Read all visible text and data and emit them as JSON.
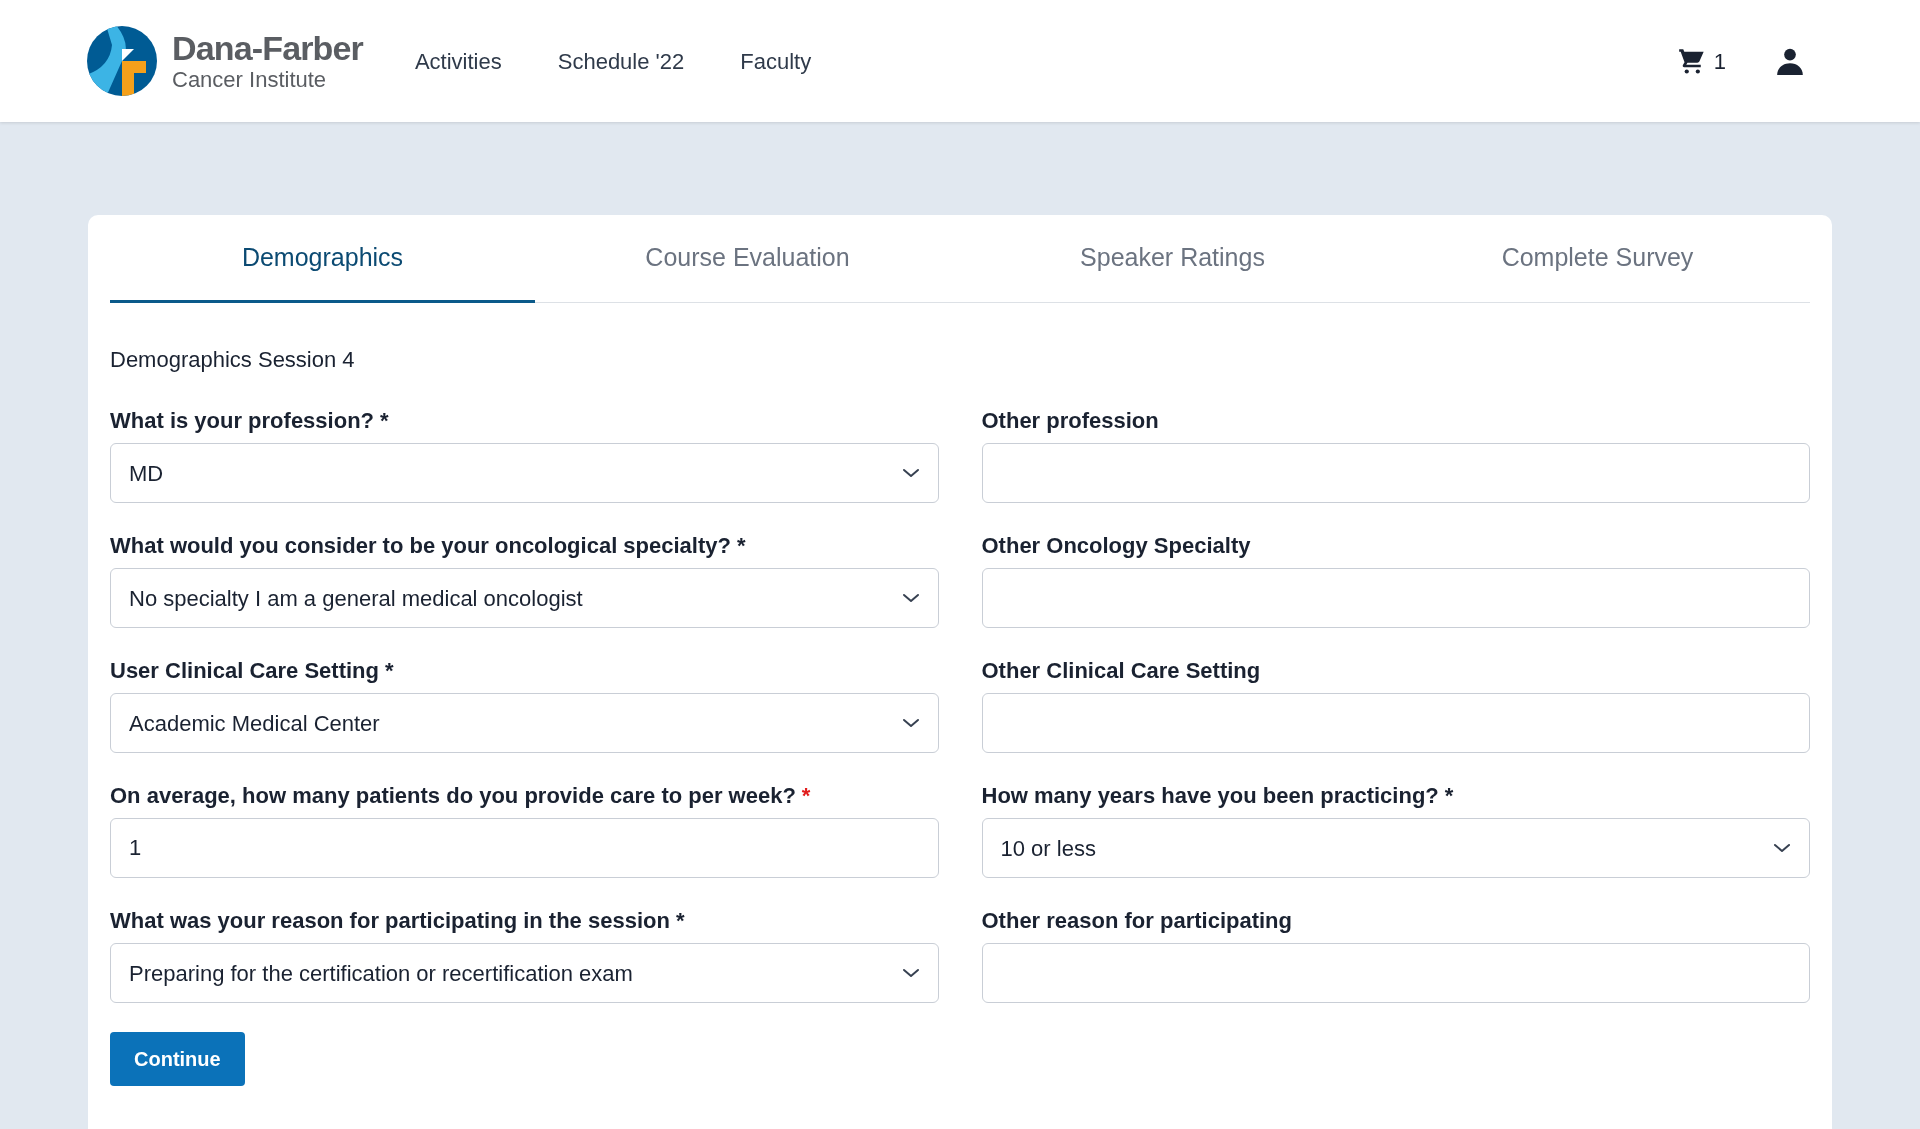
{
  "header": {
    "logo": {
      "line1": "Dana-Farber",
      "line2": "Cancer Institute"
    },
    "nav": [
      "Activities",
      "Schedule '22",
      "Faculty"
    ],
    "cart_count": "1"
  },
  "tabs": [
    {
      "label": "Demographics",
      "selected": true
    },
    {
      "label": "Course Evaluation",
      "selected": false
    },
    {
      "label": "Speaker Ratings",
      "selected": false
    },
    {
      "label": "Complete Survey",
      "selected": false
    }
  ],
  "section_title": "Demographics Session 4",
  "fields": [
    {
      "kind": "select",
      "label": "What is your profession?",
      "asterisk": "*",
      "asterisk_red": false,
      "value": "MD"
    },
    {
      "kind": "text",
      "label": "Other profession"
    },
    {
      "kind": "select",
      "label": "What would you consider to be your oncological specialty?",
      "asterisk": "*",
      "asterisk_red": false,
      "value": "No specialty I am a general medical oncologist"
    },
    {
      "kind": "text",
      "label": "Other Oncology Specialty"
    },
    {
      "kind": "select",
      "label": "User Clinical Care Setting",
      "asterisk": "*",
      "asterisk_red": false,
      "value": "Academic Medical Center"
    },
    {
      "kind": "text",
      "label": "Other Clinical Care Setting"
    },
    {
      "kind": "text",
      "label": "On average, how many patients do you provide care to per week?",
      "asterisk": "*",
      "asterisk_red": true,
      "value": "1"
    },
    {
      "kind": "select",
      "label": "How many years have you been practicing?",
      "asterisk": "*",
      "asterisk_red": false,
      "value": "10 or less"
    },
    {
      "kind": "select",
      "label": "What was your reason for participating in the session",
      "asterisk": "*",
      "asterisk_red": false,
      "value": "Preparing for the certification or recertification exam"
    },
    {
      "kind": "text",
      "label": "Other reason for participating"
    }
  ],
  "continue_button": "Continue"
}
